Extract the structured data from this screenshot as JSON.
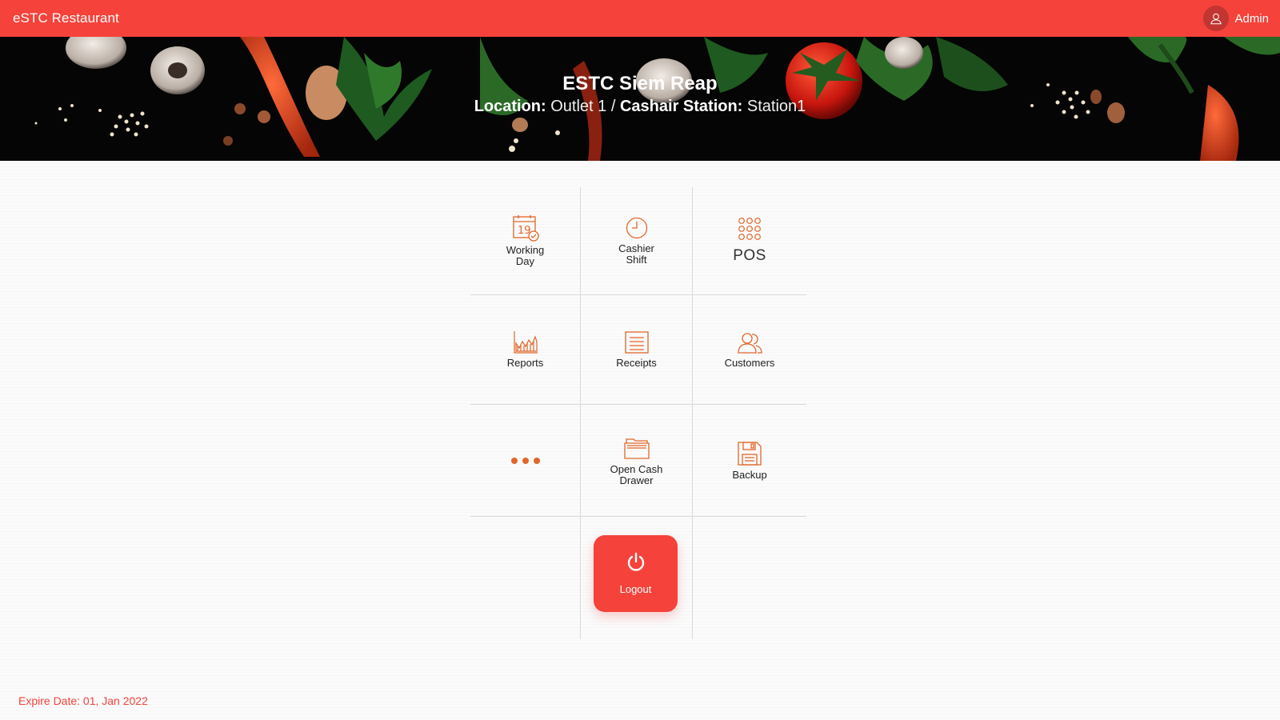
{
  "app": {
    "brand": "eSTC Restaurant",
    "user": "Admin",
    "accent": "#f5423a"
  },
  "banner": {
    "title": "ESTC Siem Reap",
    "location_label": "Location:",
    "location_value": "Outlet 1",
    "separator": "/",
    "station_label": "Cashair Station:",
    "station_value": "Station1"
  },
  "tiles": {
    "working_day": {
      "line1": "Working",
      "line2": "Day",
      "icon": "calendar-icon"
    },
    "cashier_shift": {
      "line1": "Cashier",
      "line2": "Shift",
      "icon": "clock-icon"
    },
    "pos": {
      "label": "POS",
      "icon": "grid-dots-icon"
    },
    "reports": {
      "label": "Reports",
      "icon": "chart-icon"
    },
    "receipts": {
      "label": "Receipts",
      "icon": "receipt-icon"
    },
    "customers": {
      "label": "Customers",
      "icon": "users-icon"
    },
    "more": {
      "icon": "more-icon"
    },
    "open_cash_drawer": {
      "line1": "Open Cash",
      "line2": "Drawer",
      "icon": "folder-icon"
    },
    "backup": {
      "label": "Backup",
      "icon": "save-icon"
    },
    "logout": {
      "label": "Logout",
      "icon": "power-icon"
    }
  },
  "footer": {
    "expire": "Expire Date: 01, Jan 2022"
  }
}
